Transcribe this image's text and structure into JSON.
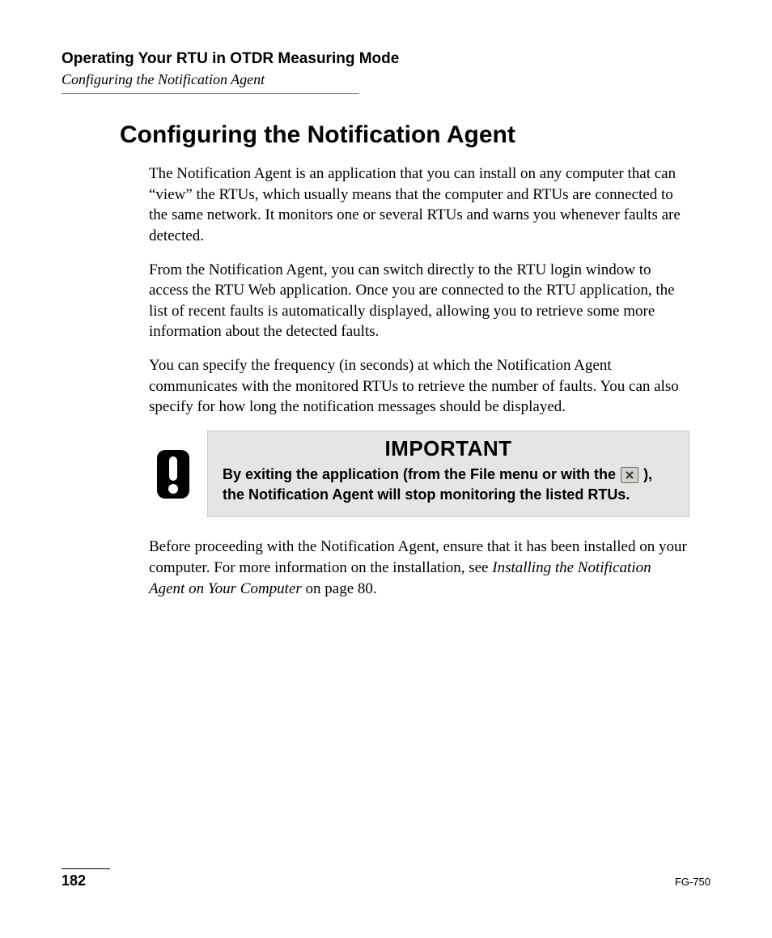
{
  "header": {
    "chapter": "Operating Your RTU in OTDR Measuring Mode",
    "section": "Configuring the Notification Agent"
  },
  "title": "Configuring the Notification Agent",
  "paragraphs": {
    "p1": "The Notification Agent is an application that you can install on any computer that can “view” the RTUs, which usually means that the computer and RTUs are connected to the same network. It monitors one or several RTUs and warns you whenever faults are detected.",
    "p2": "From the Notification Agent, you can switch directly to the RTU login window to access the RTU Web application. Once you are connected to the RTU application, the list of recent faults is automatically displayed, allowing you to retrieve some more information about the detected faults.",
    "p3": "You can specify the frequency (in seconds) at which the Notification Agent communicates with the monitored RTUs to retrieve the number of faults. You can also specify for how long the notification messages should be displayed."
  },
  "callout": {
    "label": "IMPORTANT",
    "text_before": "By exiting the application (from the File menu or with the ",
    "text_after": "), the Notification Agent will stop monitoring the listed RTUs."
  },
  "after": {
    "lead": "Before proceeding with the Notification Agent, ensure that it has been installed on your computer. For more information on the installation, see ",
    "ref": "Installing the Notification Agent on Your Computer",
    "tail": " on page 80."
  },
  "footer": {
    "page": "182",
    "doc": "FG-750"
  }
}
